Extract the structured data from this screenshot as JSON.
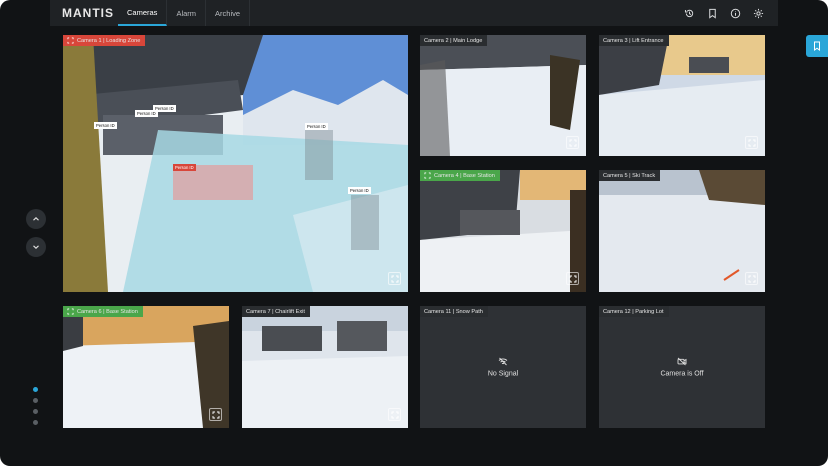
{
  "app": {
    "title": "MANTIS",
    "tabs": [
      {
        "label": "Cameras",
        "active": true
      },
      {
        "label": "Alarm",
        "active": false
      },
      {
        "label": "Archive",
        "active": false
      }
    ],
    "top_icons": [
      "history-icon",
      "bookmark-icon",
      "info-icon",
      "gear-icon"
    ]
  },
  "colors": {
    "accent": "#2aa6d8",
    "alert_red": "#d8463a",
    "ok_green": "#4aa64a",
    "background": "#111315"
  },
  "pagination": {
    "pages": 4,
    "current": 1
  },
  "cameras": [
    {
      "label": "Camera 1 | Loading Zone",
      "status": "red",
      "detections": [
        "Person ID",
        "Person ID",
        "Person ID",
        "Person ID",
        "Person ID",
        "Person ID"
      ]
    },
    {
      "label": "Camera 2 | Main Lodge",
      "status": "normal"
    },
    {
      "label": "Camera 3 | Lift Entrance",
      "status": "normal"
    },
    {
      "label": "Camera 4 | Base Station",
      "status": "green"
    },
    {
      "label": "Camera 5 | Ski Track",
      "status": "normal"
    },
    {
      "label": "Camera 6 | Base Station",
      "status": "green"
    },
    {
      "label": "Camera 7  | Chairlift Exit",
      "status": "normal"
    },
    {
      "label": "Camera 11 | Snow Path",
      "status": "no-signal",
      "message": "No Signal"
    },
    {
      "label": "Camera 12 | Parking Lot",
      "status": "off",
      "message": "Camera is Off"
    }
  ]
}
